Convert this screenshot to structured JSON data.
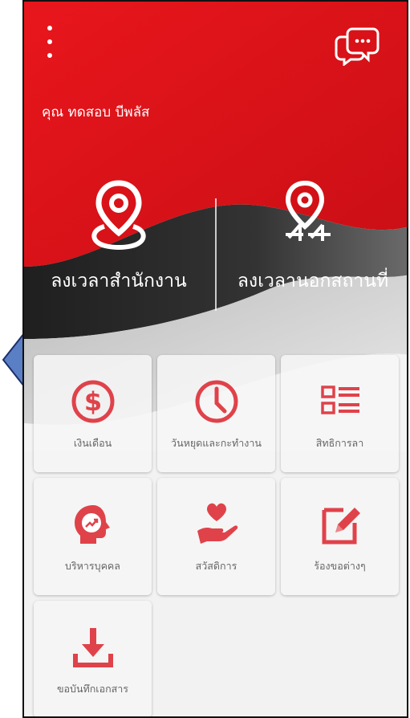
{
  "header": {
    "greeting": "คุณ ทดสอบ บีพลัส"
  },
  "checkin": {
    "office_label": "ลงเวลาสำนักงาน",
    "onsite_label": "ลงเวลานอกสถานที่"
  },
  "menu": {
    "items": [
      {
        "label": "เงินเดือน",
        "icon": "dollar-icon"
      },
      {
        "label": "วันหยุดและกะทำงาน",
        "icon": "clock-icon"
      },
      {
        "label": "สิทธิการลา",
        "icon": "list-icon"
      },
      {
        "label": "บริหารบุคคล",
        "icon": "head-growth-icon"
      },
      {
        "label": "สวัสดิการ",
        "icon": "heart-hand-icon"
      },
      {
        "label": "ร้องขอต่างๆ",
        "icon": "edit-icon"
      },
      {
        "label": "ขอบันทึกเอกสาร",
        "icon": "download-icon"
      }
    ]
  },
  "colors": {
    "brand_red": "#e3151b",
    "icon_red": "#e0424a",
    "dark_wave": "#2b2b2b"
  }
}
